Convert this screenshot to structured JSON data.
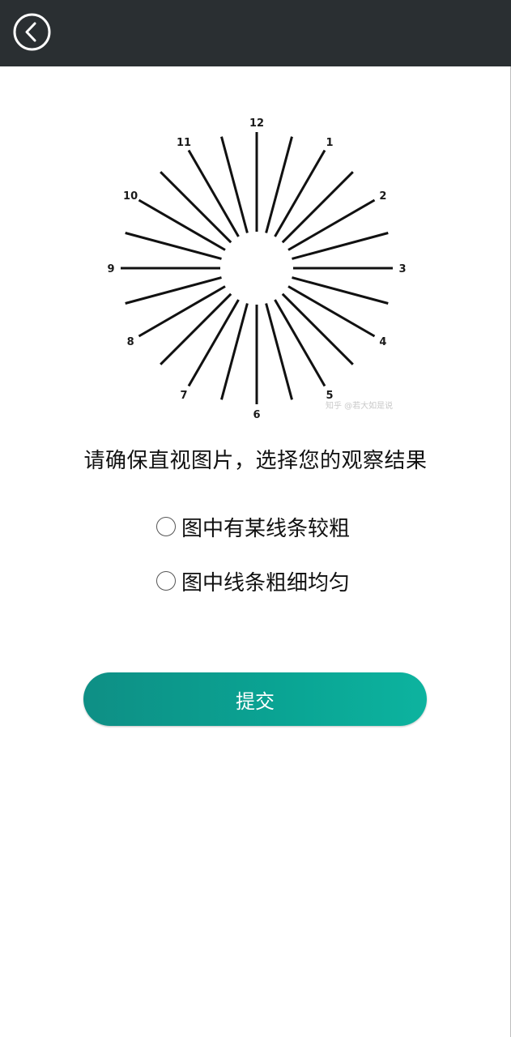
{
  "header": {
    "back_icon": "chevron-left-circle-icon"
  },
  "chart_image": {
    "numbers": [
      "12",
      "1",
      "2",
      "3",
      "4",
      "5",
      "6",
      "7",
      "8",
      "9",
      "10",
      "11"
    ],
    "watermark": "知乎 @若大如是说"
  },
  "question": {
    "instruction": "请确保直视图片，选择您的观察结果",
    "options": [
      {
        "label": "图中有某线条较粗"
      },
      {
        "label": "图中线条粗细均匀"
      }
    ]
  },
  "submit": {
    "label": "提交"
  },
  "colors": {
    "topbar": "#2a2f32",
    "accent": "#0aa594"
  }
}
